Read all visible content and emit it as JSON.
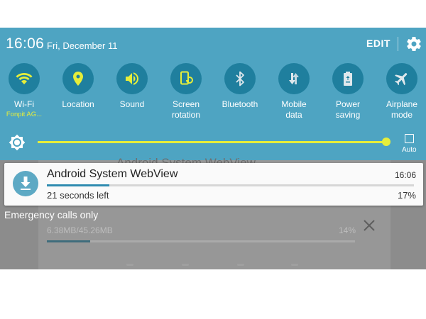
{
  "status": {
    "time": "16:06",
    "date": "Fri, December 11",
    "edit_label": "EDIT"
  },
  "toggles": [
    {
      "label": "Wi-Fi",
      "sub": "Fonpit AG...",
      "icon": "wifi-icon"
    },
    {
      "label": "Location",
      "icon": "location-icon"
    },
    {
      "label": "Sound",
      "icon": "speaker-icon"
    },
    {
      "label": "Screen\nrotation",
      "icon": "screen-rotation-icon"
    },
    {
      "label": "Bluetooth",
      "icon": "bluetooth-icon"
    },
    {
      "label": "Mobile\ndata",
      "icon": "mobile-data-icon"
    },
    {
      "label": "Power\nsaving",
      "icon": "battery-recycle-icon"
    },
    {
      "label": "Airplane\nmode",
      "icon": "airplane-icon"
    }
  ],
  "brightness": {
    "level": 0.99,
    "auto_label": "Auto"
  },
  "heads_up": {
    "title": "Android System WebView",
    "time": "16:06",
    "subtitle": "21 seconds left",
    "percent": "17%",
    "progress": 0.17
  },
  "background_notification": {
    "title": "Android System WebView",
    "size": "6.38MB/45.26MB",
    "percent": "14%",
    "progress": 0.14
  },
  "emergency_text": "Emergency calls only",
  "colors": {
    "panel": "#4ea4c2",
    "toggle_circle": "#1f7f9e",
    "accent_yellow": "#e6ee3a",
    "progress_blue": "#2f8bb0"
  }
}
